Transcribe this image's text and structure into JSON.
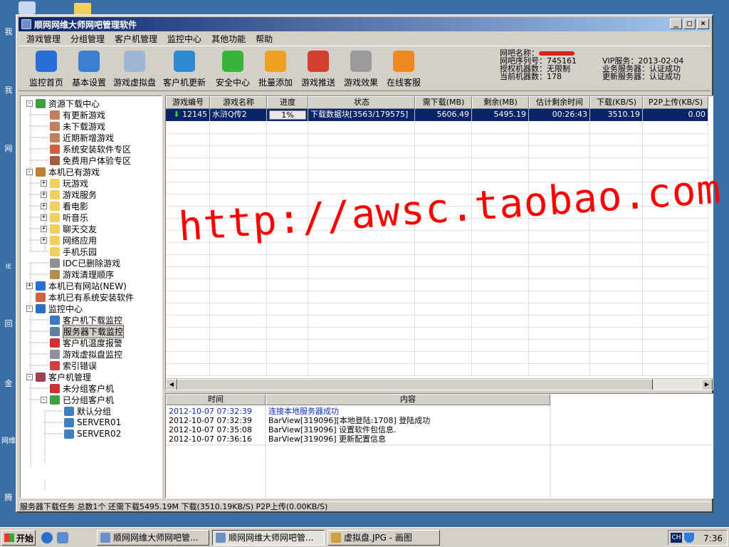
{
  "window": {
    "title": "顺网网维大师网吧管理软件"
  },
  "menu": [
    "游戏管理",
    "分组管理",
    "客户机管理",
    "监控中心",
    "其他功能",
    "帮助"
  ],
  "toolbar": [
    {
      "label": "监控首页",
      "icon": "monitor-chart-icon",
      "color": "#2b6fd6"
    },
    {
      "label": "基本设置",
      "icon": "gear-icon",
      "color": "#3a7fd0"
    },
    {
      "label": "游戏虚拟盘",
      "icon": "virtual-disk-icon",
      "color": "#9db6d6"
    },
    {
      "label": "客户机更新",
      "icon": "client-update-icon",
      "color": "#2c8ad0"
    },
    {
      "label": "安全中心",
      "icon": "security-shield-icon",
      "color": "#39b43a"
    },
    {
      "label": "批量添加",
      "icon": "batch-add-icon",
      "color": "#f0a020"
    },
    {
      "label": "游戏推送",
      "icon": "game-push-icon",
      "color": "#d04030"
    },
    {
      "label": "游戏效果",
      "icon": "gamepad-icon",
      "color": "#9a9a9a"
    },
    {
      "label": "在线客服",
      "icon": "online-service-icon",
      "color": "#f08a20"
    }
  ],
  "info": {
    "bar_name_label": "网吧名称：",
    "serial": "网吧序列号：745161",
    "licensed": "授权机器数：无限制",
    "current": "当前机器数：178",
    "vip": "VIP服务：2013-02-04",
    "biz_server": "业务服务器：认证成功",
    "update_server": "更新服务器：认证成功"
  },
  "tree": [
    {
      "label": "资源下载中心",
      "level": 0,
      "exp": "-",
      "icon": "download-center-icon",
      "color": "#3aa040"
    },
    {
      "label": "有更新游戏",
      "level": 1,
      "icon": "user-icon",
      "color": "#c08060"
    },
    {
      "label": "未下载游戏",
      "level": 1,
      "icon": "user-icon",
      "color": "#c08060"
    },
    {
      "label": "近期新增游戏",
      "level": 1,
      "icon": "user-icon",
      "color": "#c08060"
    },
    {
      "label": "系统安装软件专区",
      "level": 1,
      "icon": "software-grid-icon",
      "color": "#d06040"
    },
    {
      "label": "免费用户体验专区",
      "level": 1,
      "icon": "sofa-icon",
      "color": "#a06040"
    },
    {
      "label": "本机已有游戏",
      "level": 0,
      "exp": "-",
      "icon": "games-box-icon",
      "color": "#c08030"
    },
    {
      "label": "玩游戏",
      "level": 1,
      "exp": "+",
      "icon": "folder-icon",
      "color": "#f0d060"
    },
    {
      "label": "游戏服务",
      "level": 1,
      "exp": "+",
      "icon": "folder-icon",
      "color": "#f0d060"
    },
    {
      "label": "看电影",
      "level": 1,
      "exp": "+",
      "icon": "folder-icon",
      "color": "#f0d060"
    },
    {
      "label": "听音乐",
      "level": 1,
      "exp": "+",
      "icon": "folder-icon",
      "color": "#f0d060"
    },
    {
      "label": "聊天交友",
      "level": 1,
      "exp": "+",
      "icon": "folder-icon",
      "color": "#f0d060"
    },
    {
      "label": "网络应用",
      "level": 1,
      "exp": "+",
      "icon": "folder-icon",
      "color": "#f0d060"
    },
    {
      "label": "手机乐园",
      "level": 1,
      "icon": "folder-icon",
      "color": "#f0d060"
    },
    {
      "label": "IDC已删除游戏",
      "level": 1,
      "icon": "trash-icon",
      "color": "#909090"
    },
    {
      "label": "游戏清理顺序",
      "level": 1,
      "icon": "broom-icon",
      "color": "#b09050"
    },
    {
      "label": "本机已有网站(NEW)",
      "level": 0,
      "exp": "+",
      "icon": "ie-icon",
      "color": "#2a6fd0"
    },
    {
      "label": "本机已有系统安装软件",
      "level": 0,
      "icon": "software-grid-icon",
      "color": "#d06040"
    },
    {
      "label": "监控中心",
      "level": 0,
      "exp": "-",
      "icon": "monitor-icon",
      "color": "#2a70c0"
    },
    {
      "label": "客户机下载监控",
      "level": 1,
      "icon": "client-monitor-icon",
      "color": "#3a78c0"
    },
    {
      "label": "服务器下载监控",
      "level": 1,
      "icon": "server-monitor-icon",
      "color": "#6080a0",
      "selected": true
    },
    {
      "label": "客户机温度报警",
      "level": 1,
      "icon": "thermometer-icon",
      "color": "#d03030"
    },
    {
      "label": "游戏虚拟盘监控",
      "level": 1,
      "icon": "disk-monitor-icon",
      "color": "#9090a0"
    },
    {
      "label": "索引错误",
      "level": 1,
      "icon": "index-error-icon",
      "color": "#d04040"
    },
    {
      "label": "客户机管理",
      "level": 0,
      "exp": "-",
      "icon": "client-manage-icon",
      "color": "#a04050"
    },
    {
      "label": "未分组客户机",
      "level": 1,
      "icon": "ungrouped-icon",
      "color": "#d03030"
    },
    {
      "label": "已分组客户机",
      "level": 1,
      "exp": "-",
      "icon": "grouped-icon",
      "color": "#40a040"
    },
    {
      "label": "默认分组",
      "level": 2,
      "icon": "computer-icon",
      "color": "#4080c0"
    },
    {
      "label": "SERVER01",
      "level": 2,
      "icon": "computer-icon",
      "color": "#4080c0"
    },
    {
      "label": "SERVER02",
      "level": 2,
      "icon": "computer-icon",
      "color": "#4080c0"
    }
  ],
  "grid": {
    "columns": [
      "游戏编号",
      "游戏名称",
      "进度",
      "状态",
      "需下载(MB)",
      "剩余(MB)",
      "估计剩余时间",
      "下载(KB/S)",
      "P2P上传(KB/S)"
    ],
    "rows": [
      {
        "id": "12145",
        "name": "水浒Q传2",
        "progress": "1%",
        "status": "下载数据块[3563/179575]",
        "need": "5606.49",
        "remain": "5495.19",
        "eta": "00:26:43",
        "down": "3510.19",
        "p2p": "0.00"
      }
    ]
  },
  "log": {
    "columns": [
      "时间",
      "内容"
    ],
    "rows": [
      {
        "time": "2012-10-07 07:32:39",
        "content": "连接本地服务器成功",
        "highlight": true
      },
      {
        "time": "2012-10-07 07:32:39",
        "content": "BarView[319096][本地登陆:1708] 登陆成功"
      },
      {
        "time": "2012-10-07 07:35:08",
        "content": "BarView[319096] 设置软件包信息."
      },
      {
        "time": "2012-10-07 07:36:16",
        "content": "BarView[319096] 更新配置信息"
      }
    ]
  },
  "status": "服务器下载任务 总数1个 还需下载5495.19M 下载(3510.19KB/S) P2P上传(0.00KB/S)",
  "watermark": "http://awsc.taobao.com",
  "taskbar": {
    "start": "开始",
    "tasks": [
      "顺网网维大师网吧管...",
      "顺网网维大师网吧管...",
      "虚拟盘.JPG - 画图"
    ],
    "ime": "CH",
    "clock": "7:36"
  },
  "desktop": [
    "我",
    "我",
    "网",
    "IE",
    "回",
    "金",
    "网维",
    "腾"
  ]
}
